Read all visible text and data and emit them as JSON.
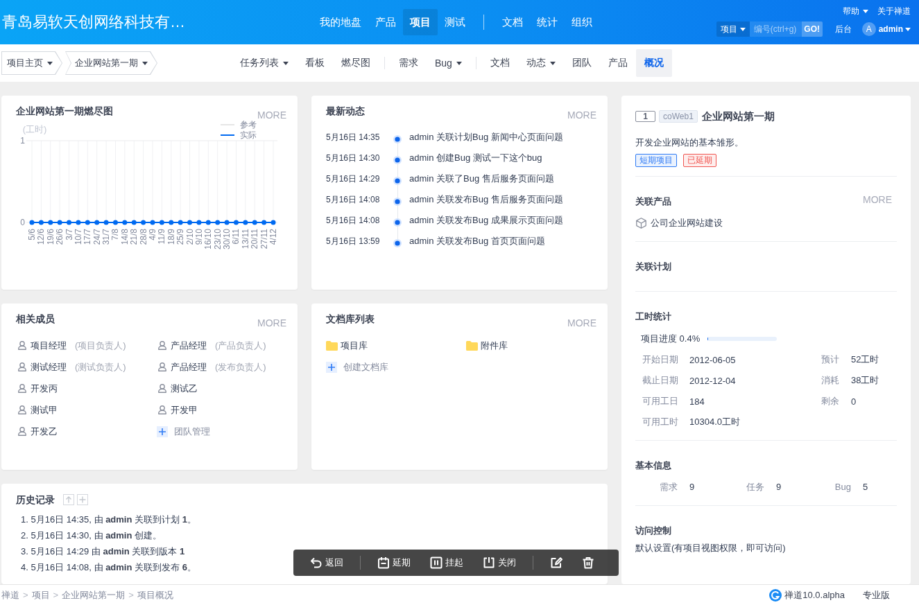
{
  "header": {
    "title": "青岛易软天创网络科技有…",
    "nav": [
      [
        {
          "label": "我的地盘",
          "selected": false
        },
        {
          "label": "产品",
          "selected": false
        },
        {
          "label": "项目",
          "selected": true
        },
        {
          "label": "测试",
          "selected": false
        }
      ],
      [
        {
          "label": "文档",
          "selected": false
        },
        {
          "label": "统计",
          "selected": false
        },
        {
          "label": "组织",
          "selected": false
        }
      ]
    ],
    "links": [
      {
        "label": "帮助",
        "dropdown": true
      },
      {
        "label": "关于禅道",
        "dropdown": false
      }
    ],
    "search": {
      "scope": "项目",
      "placeholder": "编号(ctrl+g)",
      "button": "GO!"
    },
    "admin_link": "后台",
    "user": {
      "avatar": "A",
      "name": "admin"
    }
  },
  "subnav": {
    "crumbs": [
      {
        "label": "项目主页",
        "dropdown": true
      },
      {
        "label": "企业网站第一期",
        "dropdown": true
      }
    ],
    "groups": [
      [
        {
          "label": "任务列表",
          "dropdown": true,
          "selected": false
        },
        {
          "label": "看板",
          "dropdown": false,
          "selected": false
        },
        {
          "label": "燃尽图",
          "dropdown": false,
          "selected": false
        }
      ],
      [
        {
          "label": "需求",
          "dropdown": false,
          "selected": false
        },
        {
          "label": "Bug",
          "dropdown": true,
          "selected": false
        }
      ],
      [
        {
          "label": "文档",
          "dropdown": false,
          "selected": false
        },
        {
          "label": "动态",
          "dropdown": true,
          "selected": false
        },
        {
          "label": "团队",
          "dropdown": false,
          "selected": false
        },
        {
          "label": "产品",
          "dropdown": false,
          "selected": false
        },
        {
          "label": "概况",
          "dropdown": false,
          "selected": true
        }
      ]
    ]
  },
  "burndown": {
    "more": "MORE",
    "chart_data": {
      "type": "line",
      "title": "企业网站第一期燃尽图",
      "ylabel": "(工时)",
      "categories": [
        "5/6",
        "12/6",
        "19/6",
        "26/6",
        "3/7",
        "10/7",
        "17/7",
        "24/7",
        "31/7",
        "7/8",
        "14/8",
        "21/8",
        "28/8",
        "4/9",
        "11/9",
        "18/9",
        "25/9",
        "2/10",
        "9/10",
        "16/10",
        "23/10",
        "30/10",
        "6/11",
        "13/11",
        "20/11",
        "27/11",
        "4/12"
      ],
      "series": [
        {
          "name": "参考",
          "color": "#e6e6e6",
          "values": [
            null,
            null,
            null,
            null,
            null,
            null,
            null,
            null,
            null,
            null,
            null,
            null,
            null,
            null,
            null,
            null,
            null,
            null,
            null,
            null,
            null,
            null,
            null,
            null,
            null,
            null,
            null
          ]
        },
        {
          "name": "实际",
          "color": "#006af1",
          "marker": true,
          "values": [
            0,
            0,
            0,
            0,
            0,
            0,
            0,
            0,
            0,
            0,
            0,
            0,
            0,
            0,
            0,
            0,
            0,
            0,
            0,
            0,
            0,
            0,
            0,
            0,
            0,
            0,
            0
          ]
        }
      ],
      "ylim": [
        0,
        1
      ],
      "yticks": [
        0,
        1
      ]
    }
  },
  "activity": {
    "title": "最新动态",
    "more": "MORE",
    "items": [
      {
        "time": "5月16日 14:35",
        "text": "admin 关联计划Bug 新闻中心页面问题"
      },
      {
        "time": "5月16日 14:30",
        "text": "admin 创建Bug 测试一下这个bug"
      },
      {
        "time": "5月16日 14:29",
        "text": "admin 关联了Bug 售后服务页面问题"
      },
      {
        "time": "5月16日 14:08",
        "text": "admin 关联发布Bug 售后服务页面问题"
      },
      {
        "time": "5月16日 14:08",
        "text": "admin 关联发布Bug 成果展示页面问题"
      },
      {
        "time": "5月16日 13:59",
        "text": "admin 关联发布Bug 首页页面问题"
      }
    ]
  },
  "members": {
    "title": "相关成员",
    "more": "MORE",
    "items": [
      {
        "kind": "member",
        "name": "项目经理",
        "role": "(项目负责人)"
      },
      {
        "kind": "member",
        "name": "产品经理",
        "role": "(产品负责人)"
      },
      {
        "kind": "member",
        "name": "测试经理",
        "role": "(测试负责人)"
      },
      {
        "kind": "member",
        "name": "产品经理",
        "role": "(发布负责人)"
      },
      {
        "kind": "member",
        "name": "开发丙"
      },
      {
        "kind": "member",
        "name": "测试乙"
      },
      {
        "kind": "member",
        "name": "测试甲"
      },
      {
        "kind": "member",
        "name": "开发甲"
      },
      {
        "kind": "member",
        "name": "开发乙"
      },
      {
        "kind": "action",
        "name": "团队管理"
      }
    ]
  },
  "doc_libs": {
    "title": "文档库列表",
    "more": "MORE",
    "items": [
      {
        "kind": "library",
        "name": "项目库"
      },
      {
        "kind": "library",
        "name": "附件库"
      },
      {
        "kind": "action",
        "name": "创建文档库"
      }
    ]
  },
  "history": {
    "title": "历史记录",
    "entries": [
      "1. 5月16日 14:35, 由 **admin** 关联到计划 **1**。",
      "2. 5月16日 14:30, 由 **admin** 创建。",
      "3. 5月16日 14:29 由 **admin** 关联到版本 **1**",
      "4. 5月16日 14:08, 由 **admin** 关联到发布 **6**。"
    ]
  },
  "project": {
    "number": "1",
    "code": "coWeb1",
    "name": "企业网站第一期",
    "description": "开发企业网站的基本雏形。",
    "tags": [
      {
        "label": "短期项目",
        "color": "#2f7bf5"
      },
      {
        "label": "已延期",
        "color": "#f0544f"
      }
    ],
    "products": {
      "title": "关联产品",
      "more": "MORE",
      "items": [
        "公司企业网站建设"
      ]
    },
    "plans": {
      "title": "关联计划"
    },
    "hours": {
      "title": "工时统计",
      "progress": {
        "label": "项目进度 0.4%",
        "level": 0.004
      },
      "rows": [
        [
          {
            "label": "开始日期",
            "value": "2012-06-05"
          },
          {
            "label": "预计",
            "value": "52工时"
          }
        ],
        [
          {
            "label": "截止日期",
            "value": "2012-12-04"
          },
          {
            "label": "消耗",
            "value": "38工时"
          }
        ],
        [
          {
            "label": "可用工日",
            "value": "184"
          },
          {
            "label": "剩余",
            "value": "0"
          }
        ],
        [
          {
            "label": "可用工时",
            "value": "10304.0工时"
          }
        ]
      ]
    },
    "basic": {
      "title": "基本信息",
      "counts": [
        {
          "label": "需求",
          "value": "9"
        },
        {
          "label": "任务",
          "value": "9"
        },
        {
          "label": "Bug",
          "value": "5"
        }
      ]
    },
    "access": {
      "title": "访问控制",
      "text": "默认设置(有项目视图权限，即可访问)"
    }
  },
  "toolbar": {
    "groups": [
      [
        {
          "kind": "back",
          "label": "返回"
        }
      ],
      [
        {
          "kind": "delay",
          "label": "延期"
        },
        {
          "kind": "suspend",
          "label": "挂起"
        },
        {
          "kind": "close",
          "label": "关闭"
        }
      ],
      [
        {
          "kind": "edit"
        },
        {
          "kind": "delete"
        }
      ]
    ]
  },
  "footer": {
    "breadcrumb": [
      "禅道",
      "项目",
      "企业网站第一期",
      "项目概况"
    ],
    "separator": ">",
    "version": "禅道10.0.alpha",
    "edition": "专业版"
  }
}
